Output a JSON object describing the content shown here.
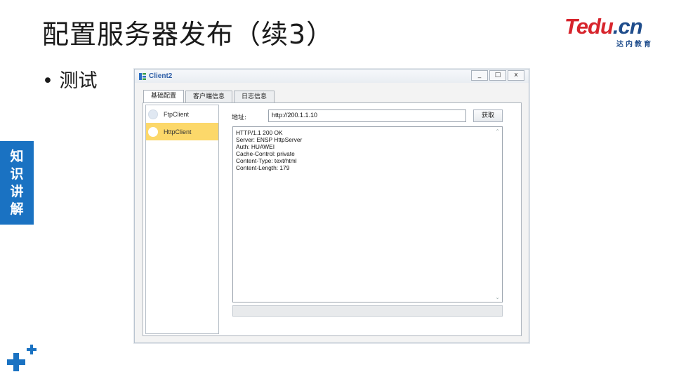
{
  "slide": {
    "title": "配置服务器发布（续3）",
    "bullet": "• 测试",
    "side_tab": [
      "知",
      "识",
      "讲",
      "解"
    ]
  },
  "logo": {
    "brand": "Tedu",
    "brand_suffix": ".cn",
    "subtitle": "达内教育"
  },
  "window": {
    "title": "Client2",
    "controls": [
      "_",
      "□",
      "x"
    ],
    "tabs": [
      {
        "label": "基础配置",
        "active": true
      },
      {
        "label": "客户端信息",
        "active": false
      },
      {
        "label": "日志信息",
        "active": false
      }
    ],
    "clients": [
      {
        "label": "FtpClient",
        "selected": false
      },
      {
        "label": "HttpClient",
        "selected": true
      }
    ],
    "address_label": "地址:",
    "address_value": "http://200.1.1.10",
    "fetch_label": "获取",
    "response_lines": [
      "HTTP/1.1 200 OK",
      "Server: ENSP HttpServer",
      "Auth: HUAWEI",
      "Cache-Control: private",
      "Content-Type: text/html",
      "Content-Length: 179"
    ]
  },
  "colors": {
    "brand_red": "#d7242c",
    "brand_blue": "#1f4d8c",
    "side_tab": "#1a72c2",
    "selected_item": "#fcd86a"
  }
}
